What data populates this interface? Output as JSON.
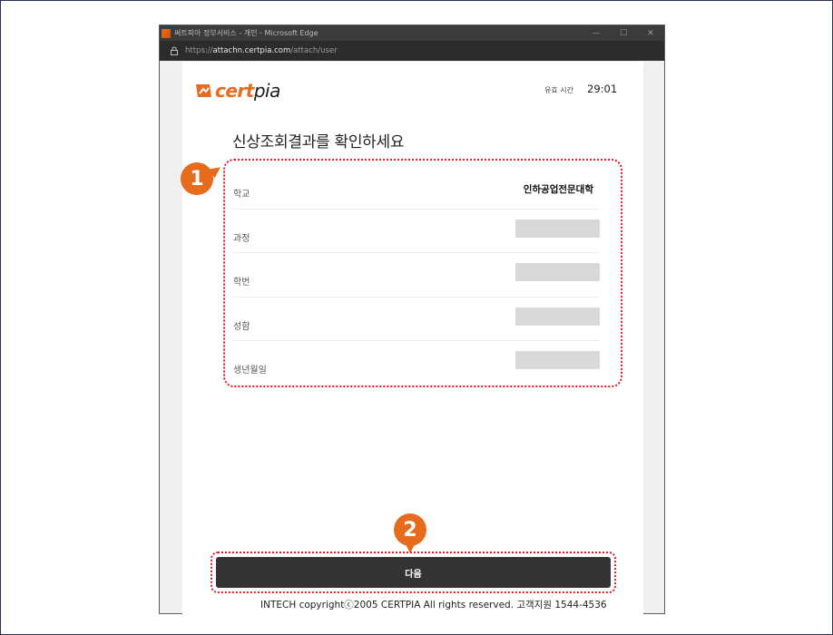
{
  "window": {
    "title": "써트피아 정부서비스 - 개인 - Microsoft Edge",
    "controls": {
      "minimize": "—",
      "maximize": "☐",
      "close": "✕"
    }
  },
  "address": {
    "scheme": "https://",
    "host": "attachn.certpia.com",
    "path": "/attach/user"
  },
  "header": {
    "logo_cert": "cert",
    "logo_pia": "pia",
    "timer_label": "유효 시간",
    "timer_value": "29:01"
  },
  "main": {
    "heading": "신상조회결과를 확인하세요",
    "rows": [
      {
        "label": "학교",
        "value": "인하공업전문대학"
      },
      {
        "label": "과정",
        "value": null
      },
      {
        "label": "학번",
        "value": null
      },
      {
        "label": "성함",
        "value": null
      },
      {
        "label": "생년월일",
        "value": null
      }
    ],
    "next_button": "다음"
  },
  "annotations": {
    "badge1": "1",
    "badge2": "2"
  },
  "footer": "INTECH copyrightⓒ2005 CERTPIA All rights reserved. 고객지원 1544-4536",
  "colors": {
    "brand": "#ea6a1e",
    "badge": "#e66b1c",
    "highlight": "#e0192b",
    "button": "#333333"
  }
}
